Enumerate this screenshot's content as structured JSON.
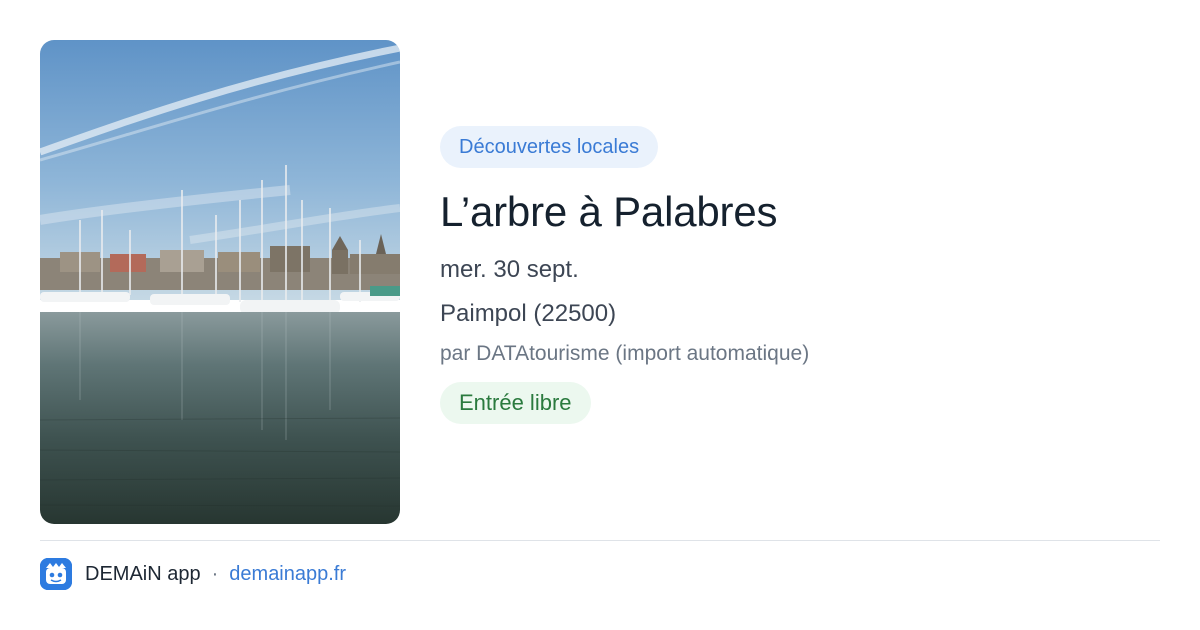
{
  "event": {
    "image_alt": "Port de plaisance de Paimpol",
    "category": "Découvertes locales",
    "title": "L’arbre à Palabres",
    "date": "mer. 30 sept.",
    "location": "Paimpol (22500)",
    "source": "par DATAtourisme (import automatique)",
    "price": "Entrée libre"
  },
  "footer": {
    "app_name": "DEMAiN app",
    "separator": "·",
    "domain": "demainapp.fr",
    "app_icon": "app-logo-icon"
  },
  "colors": {
    "category_bg": "#eaf2fc",
    "category_text": "#3a7bd5",
    "price_bg": "#ecf8ef",
    "price_text": "#2a7a3e",
    "link": "#3a7bd5",
    "title": "#15212e"
  }
}
